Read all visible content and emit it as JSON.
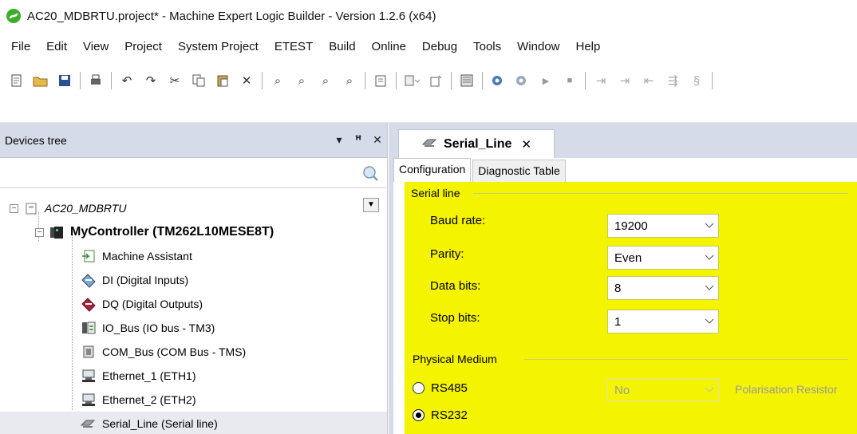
{
  "window": {
    "title": "AC20_MDBRTU.project* - Machine Expert Logic Builder - Version 1.2.6 (x64)"
  },
  "menu": [
    "File",
    "Edit",
    "View",
    "Project",
    "System Project",
    "ETEST",
    "Build",
    "Online",
    "Debug",
    "Tools",
    "Window",
    "Help"
  ],
  "devices_tree": {
    "title": "Devices tree",
    "search": {
      "value": "",
      "placeholder": ""
    },
    "root": "AC20_MDBRTU",
    "controller": "MyController (TM262L10MESE8T)",
    "children": [
      "Machine Assistant",
      "DI (Digital Inputs)",
      "DQ (Digital Outputs)",
      "IO_Bus (IO bus - TM3)",
      "COM_Bus (COM Bus - TMS)",
      "Ethernet_1 (ETH1)",
      "Ethernet_2 (ETH2)",
      "Serial_Line (Serial line)"
    ]
  },
  "editor": {
    "tab_title": "Serial_Line",
    "subtabs": [
      "Configuration",
      "Diagnostic Table"
    ],
    "serial_line": {
      "group_title": "Serial line",
      "fields": [
        {
          "label": "Baud rate:",
          "value": "19200"
        },
        {
          "label": "Parity:",
          "value": "Even"
        },
        {
          "label": "Data bits:",
          "value": "8"
        },
        {
          "label": "Stop bits:",
          "value": "1"
        }
      ]
    },
    "physical_medium": {
      "group_title": "Physical Medium",
      "rs485": "RS485",
      "rs232": "RS232",
      "polarisation_value": "No",
      "polarisation_label": "Polarisation Resistor",
      "selected": "RS232"
    },
    "highlight_color": "#f4f400"
  }
}
